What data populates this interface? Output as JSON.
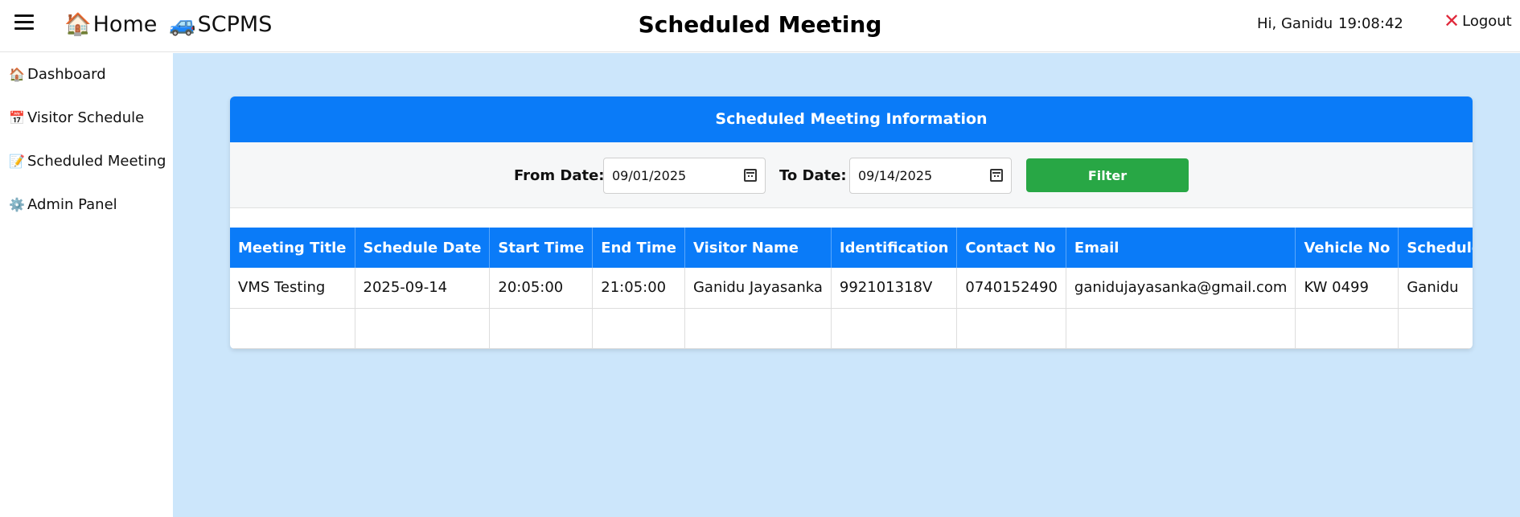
{
  "header": {
    "home_label": "Home",
    "home_icon": "🏠",
    "brand_label": "SCPMS",
    "brand_icon": "🚙",
    "title": "Scheduled Meeting",
    "greeting": "Hi, Ganidu",
    "time": "19:08:42",
    "logout_label": "Logout",
    "logout_icon": "close-icon"
  },
  "sidebar": {
    "items": [
      {
        "icon": "🏠",
        "label": "Dashboard"
      },
      {
        "icon": "📅",
        "label": "Visitor Schedule"
      },
      {
        "icon": "📝",
        "label": "Scheduled Meeting"
      },
      {
        "icon": "⚙️",
        "label": "Admin Panel"
      }
    ]
  },
  "card": {
    "title": "Scheduled Meeting Information"
  },
  "filter": {
    "from_label": "From Date:",
    "from_value": "09/01/2025",
    "to_label": "To Date:",
    "to_value": "09/14/2025",
    "button_label": "Filter"
  },
  "table": {
    "columns": [
      "Meeting Title",
      "Schedule Date",
      "Start Time",
      "End Time",
      "Visitor Name",
      "Identification",
      "Contact No",
      "Email",
      "Vehicle No",
      "Scheduled Person"
    ],
    "rows": [
      [
        "VMS Testing",
        "2025-09-14",
        "20:05:00",
        "21:05:00",
        "Ganidu Jayasanka",
        "992101318V",
        "0740152490",
        "ganidujayasanka@gmail.com",
        "KW 0499",
        "Ganidu"
      ],
      [
        "",
        "",
        "",
        "",
        "",
        "",
        "",
        "",
        "",
        ""
      ]
    ]
  },
  "colors": {
    "primary": "#0a7bf8",
    "success": "#28a745",
    "main_bg": "#cce6fb",
    "logout_icon": "#e0283a"
  }
}
